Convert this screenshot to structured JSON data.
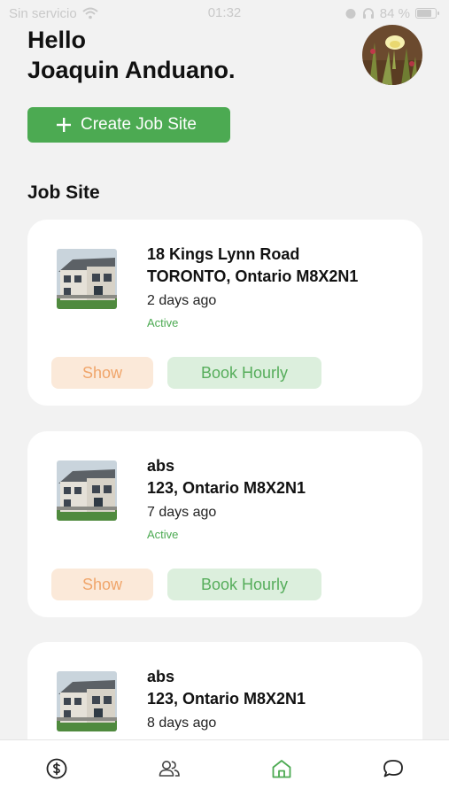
{
  "status_bar": {
    "carrier": "Sin servicio",
    "time": "01:32",
    "battery": "84 %",
    "battery_level": 0.84
  },
  "header": {
    "greeting_line1": "Hello",
    "greeting_line2": "Joaquin Anduano."
  },
  "create_button": {
    "label": "Create Job Site"
  },
  "section_title": "Job Site",
  "job_sites": [
    {
      "line1": "18 Kings Lynn Road",
      "line2": "TORONTO, Ontario M8X2N1",
      "ago": "2 days ago",
      "status": "Active",
      "show_label": "Show",
      "book_label": "Book Hourly"
    },
    {
      "line1": "abs",
      "line2": "123, Ontario M8X2N1",
      "ago": "7 days ago",
      "status": "Active",
      "show_label": "Show",
      "book_label": "Book Hourly"
    },
    {
      "line1": "abs",
      "line2": "123, Ontario M8X2N1",
      "ago": "8 days ago"
    }
  ],
  "bottom_nav": {
    "items": [
      "dollar-icon",
      "users-icon",
      "home-icon",
      "chat-icon"
    ],
    "active": "home-icon"
  },
  "colors": {
    "accent": "#4caa52",
    "show_bg": "#fbe9d9",
    "show_text": "#f0a56a",
    "book_bg": "#dcefdd",
    "book_text": "#56ad5b"
  }
}
